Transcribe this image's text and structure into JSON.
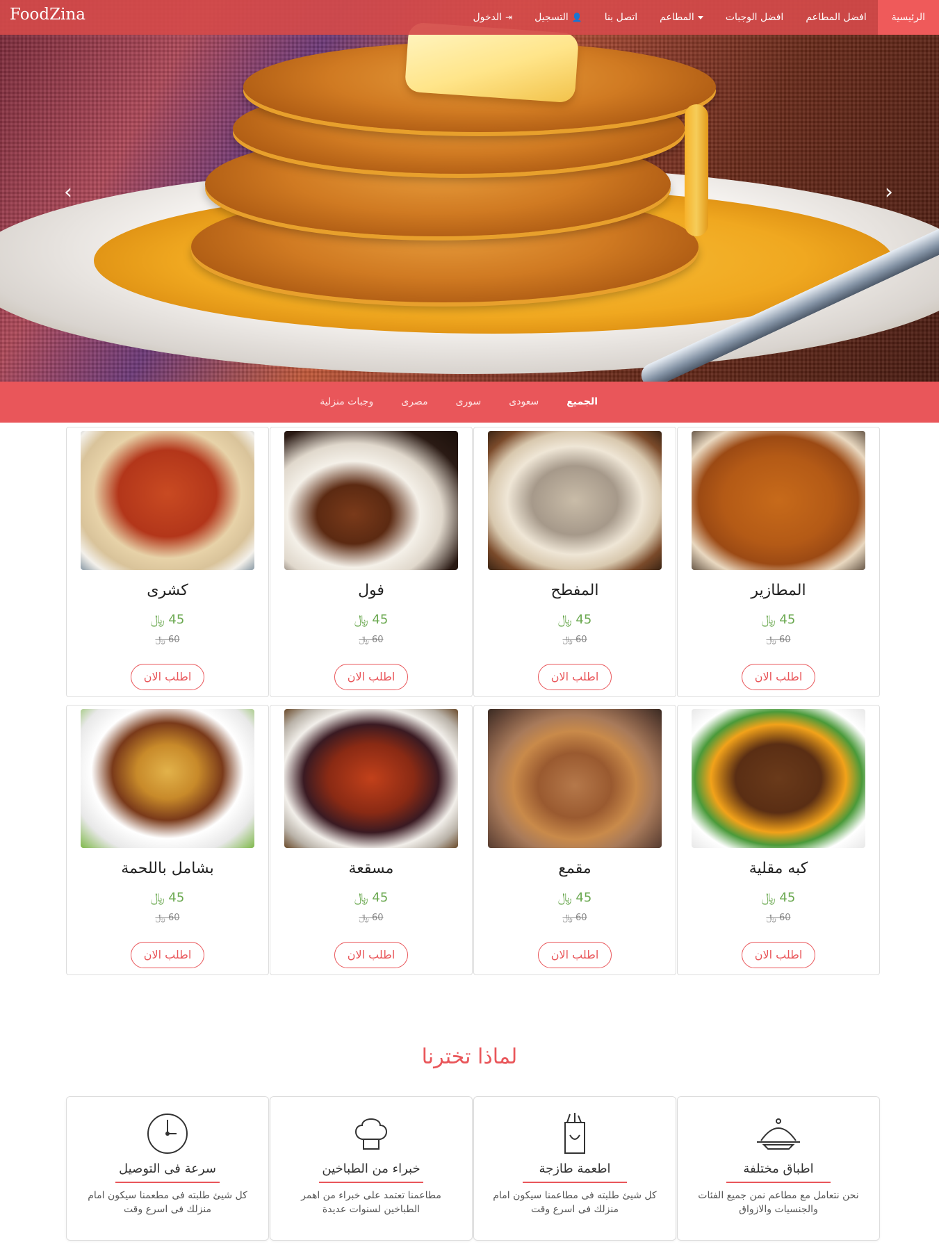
{
  "brand": "FoodZina",
  "nav": {
    "items": [
      {
        "label": "الرئيسية",
        "active": true
      },
      {
        "label": "افضل المطاعم"
      },
      {
        "label": "افضل الوجبات"
      },
      {
        "label": "المطاعم",
        "dropdown": true
      },
      {
        "label": "اتصل بنا"
      },
      {
        "label": "التسجيل",
        "icon": "user-icon"
      },
      {
        "label": "الدخول",
        "icon": "login-icon"
      }
    ]
  },
  "hero": {
    "prev_icon": "chevron-left-icon",
    "next_icon": "chevron-right-icon"
  },
  "categories": [
    {
      "label": "الجميع",
      "active": true
    },
    {
      "label": "سعودى"
    },
    {
      "label": "سورى"
    },
    {
      "label": "مصرى"
    },
    {
      "label": "وجبات منزلية"
    }
  ],
  "products": [
    {
      "name": "المطازير",
      "price": "45 ﷼",
      "old_price": "60 ﷼",
      "button": "اطلب الان",
      "image": "matazeez"
    },
    {
      "name": "المفطح",
      "price": "45 ﷼",
      "old_price": "60 ﷼",
      "button": "اطلب الان",
      "image": "mufattah"
    },
    {
      "name": "فول",
      "price": "45 ﷼",
      "old_price": "60 ﷼",
      "button": "اطلب الان",
      "image": "ful"
    },
    {
      "name": "كشرى",
      "price": "45 ﷼",
      "old_price": "60 ﷼",
      "button": "اطلب الان",
      "image": "koshari"
    },
    {
      "name": "كبه مقلية",
      "price": "45 ﷼",
      "old_price": "60 ﷼",
      "button": "اطلب الان",
      "image": "kobba"
    },
    {
      "name": "مقمع",
      "price": "45 ﷼",
      "old_price": "60 ﷼",
      "button": "اطلب الان",
      "image": "maqmaa"
    },
    {
      "name": "مسقعة",
      "price": "45 ﷼",
      "old_price": "60 ﷼",
      "button": "اطلب الان",
      "image": "musakaa"
    },
    {
      "name": "بشامل باللحمة",
      "price": "45 ﷼",
      "old_price": "60 ﷼",
      "button": "اطلب الان",
      "image": "bechamel"
    }
  ],
  "why": {
    "title": "لماذا تخترنا",
    "cards": [
      {
        "title": "اطباق مختلفة",
        "text": "نحن نتعامل مع مطاعم نمن جميع الفئات والجنسيات والازواق",
        "icon": "serving-dish-icon"
      },
      {
        "title": "اطعمة طازجة",
        "text": "كل شيئ طلبته فى مطاعمنا سيكون امام منزلك فى اسرع وقت",
        "icon": "grocery-bag-icon"
      },
      {
        "title": "خبراء من الطباخين",
        "text": "مطاعمنا تعتمد على خبراء من اهمر الطباخين لسنوات عديدة",
        "icon": "chef-hat-icon"
      },
      {
        "title": "سرعة فى التوصيل",
        "text": "كل شيئ طلبته فى مطعمنا سيكون امام منزلك فى اسرع وقت",
        "icon": "clock-icon"
      }
    ]
  },
  "colors": {
    "accent": "#e9565a",
    "price": "#6aa84f"
  }
}
